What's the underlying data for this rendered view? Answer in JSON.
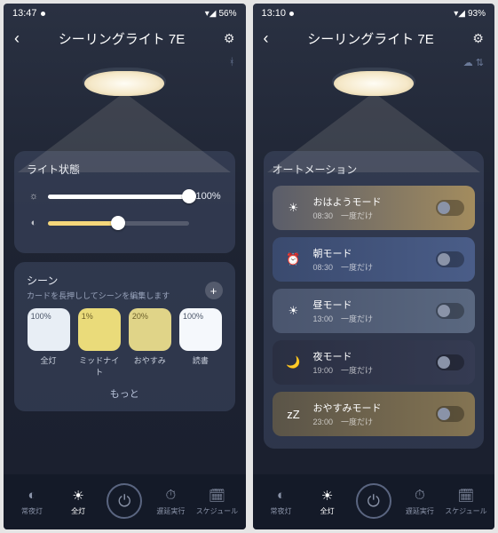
{
  "left": {
    "status": {
      "time": "13:47",
      "battery": "56%"
    },
    "conn_kind": "bt",
    "header": {
      "title": "シーリングライト 7E"
    },
    "light_status": {
      "title": "ライト状態",
      "brightness": 100,
      "brightness_label": "100%",
      "warmth": 50
    },
    "scenes": {
      "title": "シーン",
      "subtitle": "カードを長押ししてシーンを編集します",
      "more": "もっと",
      "items": [
        {
          "label": "全灯",
          "pct": "100%",
          "bg": "#e8eef5",
          "fg": "#4a5568"
        },
        {
          "label": "ミッドナイト",
          "pct": "1%",
          "bg": "#eadb7a",
          "fg": "#6b5f2a"
        },
        {
          "label": "おやすみ",
          "pct": "20%",
          "bg": "#e0d488",
          "fg": "#6b5f2a"
        },
        {
          "label": "読書",
          "pct": "100%",
          "bg": "#f5f8fc",
          "fg": "#4a5568"
        }
      ]
    },
    "nav": [
      "常夜灯",
      "全灯",
      "",
      "遅延実行",
      "スケジュール"
    ]
  },
  "right": {
    "status": {
      "time": "13:10",
      "battery": "93%"
    },
    "conn_kind": "cloud",
    "header": {
      "title": "シーリングライト 7E"
    },
    "automation": {
      "title": "オートメーション",
      "items": [
        {
          "name": "おはようモード",
          "time": "08:30",
          "freq": "一度だけ",
          "bg": "linear-gradient(90deg,#5a5d6a,#a38c5e)",
          "icon": "☀"
        },
        {
          "name": "朝モード",
          "time": "08:30",
          "freq": "一度だけ",
          "bg": "linear-gradient(90deg,#3a4a6e,#4a5d88)",
          "icon": "⏰"
        },
        {
          "name": "昼モード",
          "time": "13:00",
          "freq": "一度だけ",
          "bg": "linear-gradient(90deg,#4a556e,#5a6880)",
          "icon": "☀"
        },
        {
          "name": "夜モード",
          "time": "19:00",
          "freq": "一度だけ",
          "bg": "linear-gradient(90deg,#2a2f42,#353b52)",
          "icon": "🌙"
        },
        {
          "name": "おやすみモード",
          "time": "23:00",
          "freq": "一度だけ",
          "bg": "linear-gradient(90deg,#5a5448,#847452)",
          "icon": "zZ"
        }
      ]
    },
    "nav": [
      "常夜灯",
      "全灯",
      "",
      "遅延実行",
      "スケジュール"
    ]
  }
}
